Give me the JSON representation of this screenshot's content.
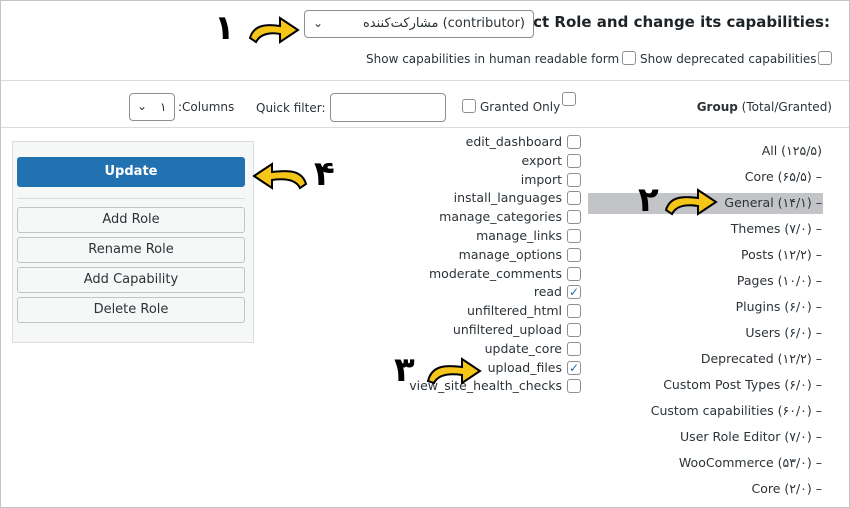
{
  "header": {
    "title": "Select Role and change its capabilities:",
    "role_select_value": "مشارکت‌کننده (contributor)",
    "show_human_readable": "Show capabilities in human readable form",
    "show_deprecated": "Show deprecated capabilities"
  },
  "toolbar": {
    "group_label_bold": "Group",
    "group_label_rest": " (Total/Granted)",
    "granted_only": "Granted Only",
    "quick_filter": "Quick filter:",
    "columns_label": "Columns:",
    "columns_value": "۱"
  },
  "capabilities": [
    {
      "label": "edit_dashboard",
      "checked": false
    },
    {
      "label": "export",
      "checked": false
    },
    {
      "label": "import",
      "checked": false
    },
    {
      "label": "install_languages",
      "checked": false
    },
    {
      "label": "manage_categories",
      "checked": false
    },
    {
      "label": "manage_links",
      "checked": false
    },
    {
      "label": "manage_options",
      "checked": false
    },
    {
      "label": "moderate_comments",
      "checked": false
    },
    {
      "label": "read",
      "checked": true
    },
    {
      "label": "unfiltered_html",
      "checked": false
    },
    {
      "label": "unfiltered_upload",
      "checked": false
    },
    {
      "label": "update_core",
      "checked": false
    },
    {
      "label": "upload_files",
      "checked": true
    },
    {
      "label": "view_site_health_checks",
      "checked": false
    }
  ],
  "groups": [
    "All (۱۲۵/۵)",
    "Core (۶۵/۵) –",
    "General (۱۴/۱) –",
    "Themes (۷/۰) –",
    "Posts (۱۲/۲) –",
    "Pages (۱۰/۰) –",
    "Plugins (۶/۰) –",
    "Users (۶/۰) –",
    "Deprecated (۱۲/۲) –",
    "Custom Post Types (۶/۰) –",
    "Custom capabilities (۶۰/۰) –",
    "User Role Editor (۷/۰) –",
    "WooCommerce (۵۳/۰) –",
    "Core (۲/۰) –"
  ],
  "actions": {
    "update": "Update",
    "add_role": "Add Role",
    "rename_role": "Rename Role",
    "add_capability": "Add Capability",
    "delete_role": "Delete Role"
  },
  "annotations": {
    "n1": "۱",
    "n2": "۲",
    "n3": "۳",
    "n4": "۴"
  },
  "colors": {
    "primary": "#2271b1",
    "arrow_fill": "#f5c518",
    "selected_group_bg": "#c3c4c7"
  }
}
